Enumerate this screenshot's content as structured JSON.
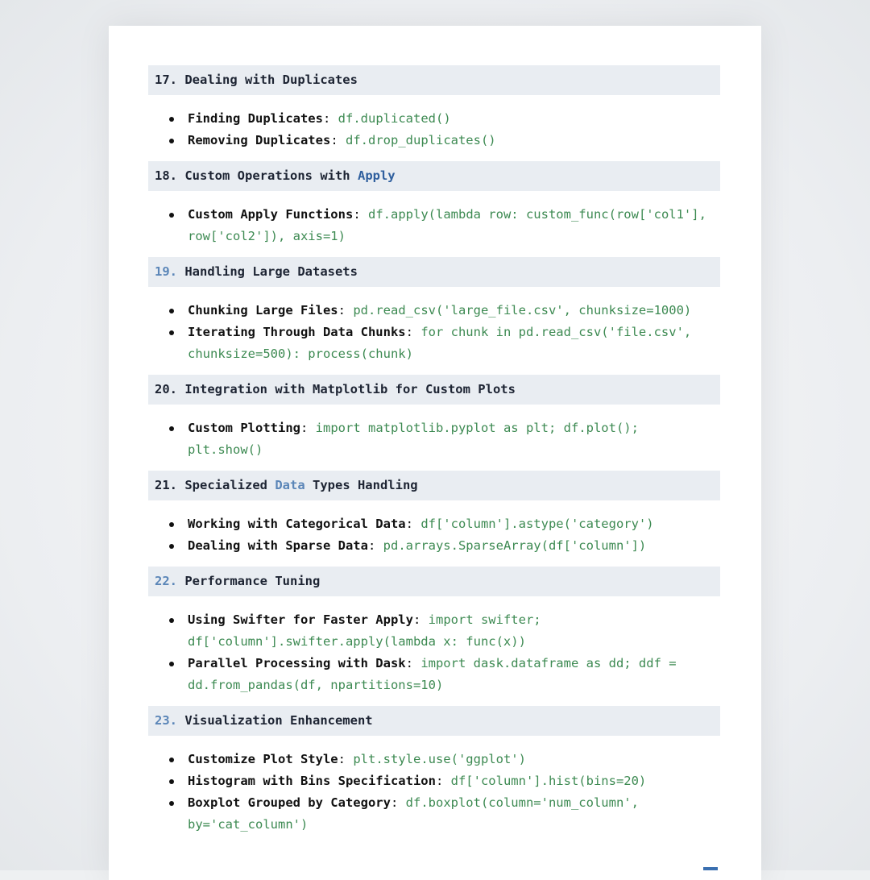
{
  "sections": [
    {
      "number": "17.",
      "title_parts": [
        {
          "text": "Dealing with Duplicates",
          "style": "plain"
        }
      ],
      "items": [
        {
          "label": "Finding Duplicates",
          "code": "df.duplicated()"
        },
        {
          "label": "Removing Duplicates",
          "code": "df.drop_duplicates()"
        }
      ]
    },
    {
      "number": "18.",
      "title_parts": [
        {
          "text": "Custom Operations with ",
          "style": "plain"
        },
        {
          "text": "Apply",
          "style": "kw-blue"
        }
      ],
      "items": [
        {
          "label": "Custom Apply Functions",
          "code": "df.apply(lambda row: custom_func(row['col1'], row['col2']), axis=1)"
        }
      ]
    },
    {
      "number": "19.",
      "number_style": "num-blue",
      "title_parts": [
        {
          "text": "Handling Large Datasets",
          "style": "plain"
        }
      ],
      "items": [
        {
          "label": "Chunking Large Files",
          "code": "pd.read_csv('large_file.csv', chunksize=1000)"
        },
        {
          "label": "Iterating Through Data Chunks",
          "code": "for chunk in pd.read_csv('file.csv', chunksize=500): process(chunk)"
        }
      ]
    },
    {
      "number": "20.",
      "title_parts": [
        {
          "text": "Integration with Matplotlib for Custom Plots",
          "style": "plain"
        }
      ],
      "items": [
        {
          "label": "Custom Plotting",
          "code": "import matplotlib.pyplot as plt; df.plot(); plt.show()"
        }
      ]
    },
    {
      "number": "21.",
      "title_parts": [
        {
          "text": "Specialized ",
          "style": "plain"
        },
        {
          "text": "Data",
          "style": "kw-lightblue"
        },
        {
          "text": " Types Handling",
          "style": "plain"
        }
      ],
      "items": [
        {
          "label": "Working with Categorical Data",
          "code": "df['column'].astype('category')"
        },
        {
          "label": "Dealing with Sparse Data",
          "code": "pd.arrays.SparseArray(df['column'])"
        }
      ]
    },
    {
      "number": "22.",
      "number_style": "num-blue",
      "title_parts": [
        {
          "text": "Performance Tuning",
          "style": "plain"
        }
      ],
      "items": [
        {
          "label": "Using Swifter for Faster Apply",
          "code": "import swifter; df['column'].swifter.apply(lambda x: func(x))"
        },
        {
          "label": "Parallel Processing with Dask",
          "code": "import dask.dataframe as dd; ddf = dd.from_pandas(df, npartitions=10)"
        }
      ]
    },
    {
      "number": "23.",
      "number_style": "num-blue",
      "title_parts": [
        {
          "text": "Visualization Enhancement",
          "style": "plain"
        }
      ],
      "items": [
        {
          "label": "Customize Plot Style",
          "code": "plt.style.use('ggplot')"
        },
        {
          "label": "Histogram with Bins Specification",
          "code": "df['column'].hist(bins=20)"
        },
        {
          "label": "Boxplot Grouped by Category",
          "code": "df.boxplot(column='num_column', by='cat_column')"
        }
      ]
    }
  ],
  "separator": ":",
  "colors": {
    "code": "#3d8a52",
    "heading_bg": "#e9edf2",
    "keyword_blue": "#2f5f9e",
    "number_blue": "#5b86b8"
  }
}
